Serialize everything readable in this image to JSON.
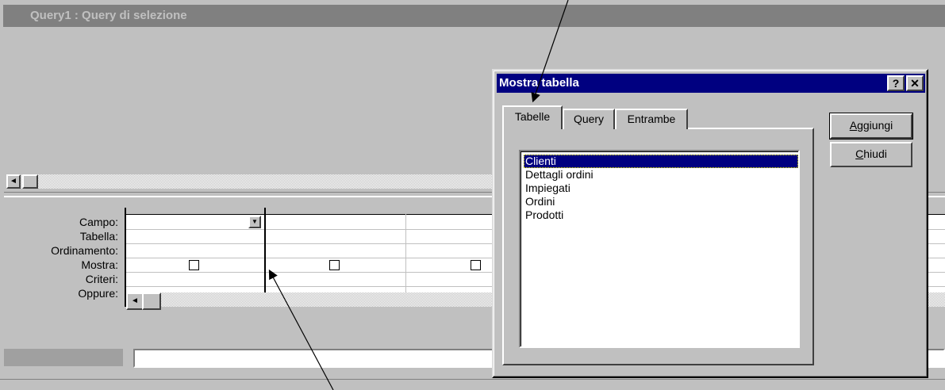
{
  "window": {
    "title": "Query1 : Query di selezione",
    "icon": "query-window-icon"
  },
  "upper_pane": {
    "scroll_left_glyph": "◄"
  },
  "design_grid": {
    "row_labels": [
      "Campo:",
      "Tabella:",
      "Ordinamento:",
      "Mostra:",
      "Criteri:",
      "Oppure:"
    ],
    "field_dropdown_glyph": "▼",
    "scroll_left_glyph": "◄"
  },
  "dialog": {
    "title": "Mostra tabella",
    "help_label": "?",
    "close_label": "✕",
    "tabs": [
      {
        "label": "Tabelle",
        "selected": true
      },
      {
        "label": "Query",
        "selected": false
      },
      {
        "label": "Entrambe",
        "selected": false
      }
    ],
    "list_items": [
      {
        "label": "Clienti",
        "selected": true
      },
      {
        "label": "Dettagli ordini",
        "selected": false
      },
      {
        "label": "Impiegati",
        "selected": false
      },
      {
        "label": "Ordini",
        "selected": false
      },
      {
        "label": "Prodotti",
        "selected": false
      }
    ],
    "buttons": {
      "add": {
        "mnemonic": "A",
        "rest": "ggiungi"
      },
      "close": {
        "mnemonic": "C",
        "rest": "hiudi"
      }
    }
  },
  "colors": {
    "face": "#c0c0c0",
    "active_title": "#000080",
    "inactive_title": "#808080",
    "selection": "#000080"
  }
}
